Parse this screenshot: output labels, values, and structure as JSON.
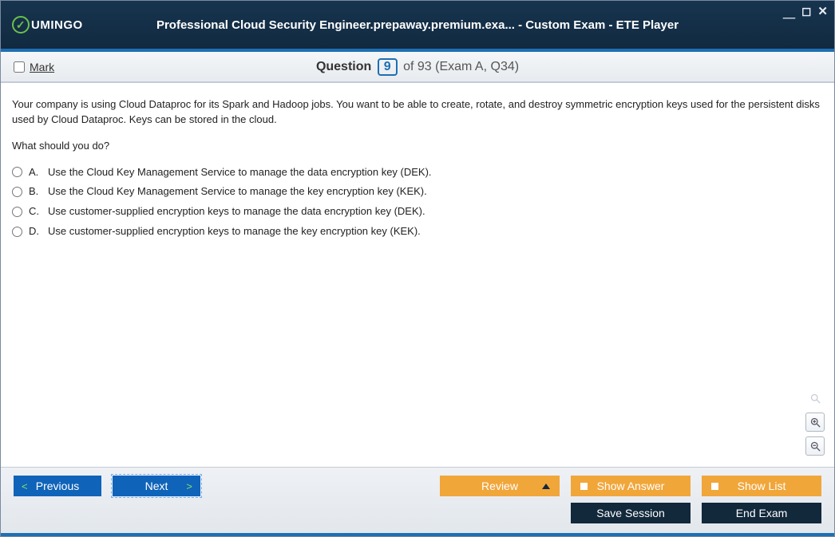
{
  "window": {
    "title": "Professional Cloud Security Engineer.prepaway.premium.exa... - Custom Exam - ETE Player",
    "brand": "UMINGO"
  },
  "header": {
    "mark_label": "Mark",
    "question_word": "Question",
    "current": "9",
    "total": "93",
    "context": "(Exam A, Q34)"
  },
  "question": {
    "text": "Your company is using Cloud Dataproc for its Spark and Hadoop jobs. You want to be able to create, rotate, and destroy symmetric encryption keys used for the persistent disks used by Cloud Dataproc. Keys can be stored in the cloud.",
    "prompt": "What should you do?",
    "options": [
      {
        "letter": "A.",
        "text": "Use the Cloud Key Management Service to manage the data encryption key (DEK)."
      },
      {
        "letter": "B.",
        "text": "Use the Cloud Key Management Service to manage the key encryption key (KEK)."
      },
      {
        "letter": "C.",
        "text": "Use customer-supplied encryption keys to manage the data encryption key (DEK)."
      },
      {
        "letter": "D.",
        "text": "Use customer-supplied encryption keys to manage the key encryption key (KEK)."
      }
    ]
  },
  "footer": {
    "previous": "Previous",
    "next": "Next",
    "review": "Review",
    "show_answer": "Show Answer",
    "show_list": "Show List",
    "save_session": "Save Session",
    "end_exam": "End Exam"
  }
}
